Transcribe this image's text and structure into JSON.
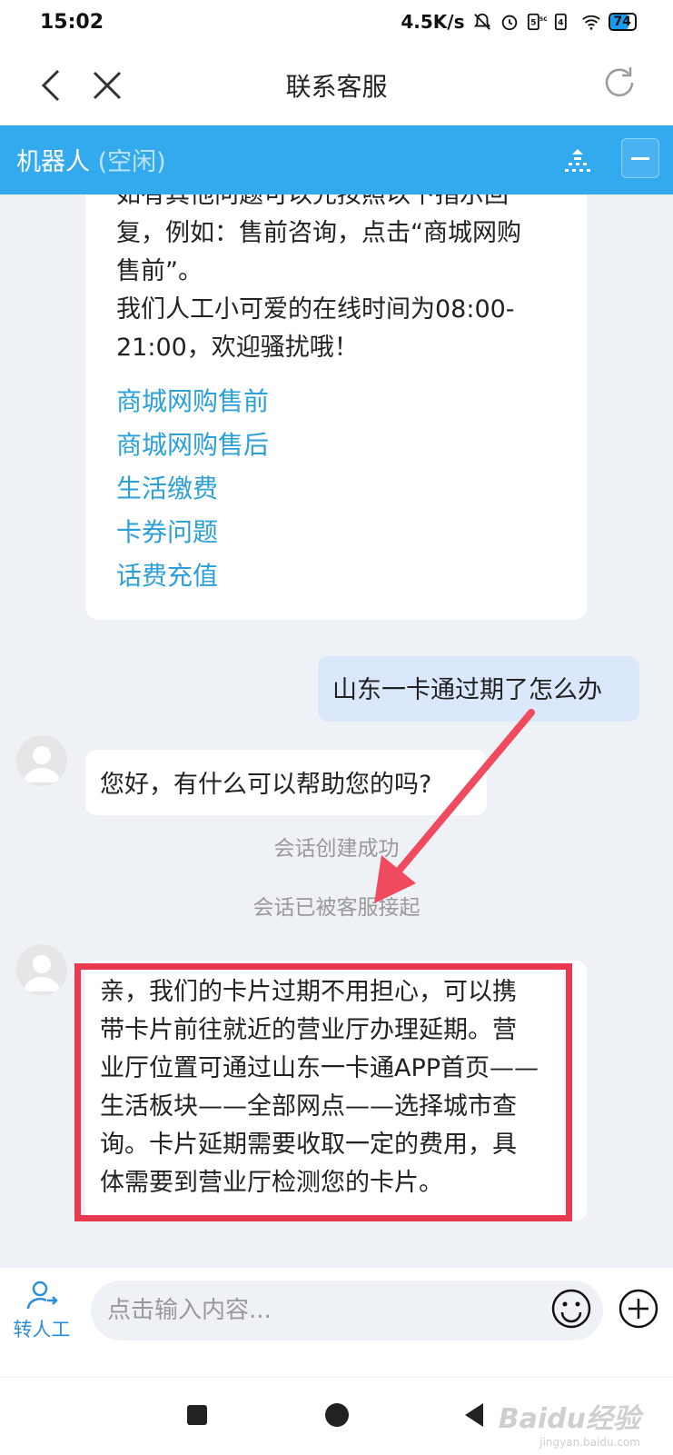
{
  "status_bar": {
    "time": "15:02",
    "net_speed": "4.5K/s",
    "battery": "74"
  },
  "navbar": {
    "title": "联系客服"
  },
  "robot_bar": {
    "name": "机器人",
    "status": "(空闲)"
  },
  "chat": {
    "bot_intro_lines": [
      "如有其他问题可以先按照以下指示回",
      "复，例如：售前咨询，点击“商城网购",
      "售前”。",
      "我们人工小可爱的在线时间为08:00-",
      "21:00，欢迎骚扰哦！"
    ],
    "quick_links": [
      "商城网购售前",
      "商城网购售后",
      "生活缴费",
      "卡券问题",
      "话费充值"
    ],
    "user_message": "山东一卡通过期了怎么办",
    "bot_greeting": "您好，有什么可以帮助您的吗?",
    "system_notices": [
      "会话创建成功",
      "会话已被客服接起"
    ],
    "agent_reply_lines": [
      "亲，我们的卡片过期不用担心，可以携",
      "带卡片前往就近的营业厅办理延期。营",
      "业厅位置可通过山东一卡通APP首页——",
      "生活板块——全部网点——选择城市查",
      "询。卡片延期需要收取一定的费用，具",
      "体需要到营业厅检测您的卡片。"
    ]
  },
  "input_bar": {
    "transfer_label": "转人工",
    "placeholder": "点击输入内容..."
  },
  "watermark": {
    "brand": "Baidu经验",
    "sub": "jingyan.baidu.com"
  },
  "colors": {
    "accent": "#34aaee",
    "link": "#2a9fd8",
    "highlight": "#e8394f"
  }
}
